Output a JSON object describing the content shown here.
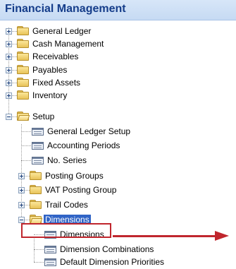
{
  "header": {
    "title": "Financial Management"
  },
  "tree": {
    "items": [
      {
        "label": "General Ledger",
        "kind": "folder",
        "state": "collapsed"
      },
      {
        "label": "Cash Management",
        "kind": "folder",
        "state": "collapsed"
      },
      {
        "label": "Receivables",
        "kind": "folder",
        "state": "collapsed"
      },
      {
        "label": "Payables",
        "kind": "folder",
        "state": "collapsed"
      },
      {
        "label": "Fixed Assets",
        "kind": "folder",
        "state": "collapsed"
      },
      {
        "label": "Inventory",
        "kind": "folder",
        "state": "collapsed"
      },
      {
        "label": "Setup",
        "kind": "folder",
        "state": "expanded"
      },
      {
        "label": "General Ledger Setup",
        "kind": "page"
      },
      {
        "label": "Accounting Periods",
        "kind": "page"
      },
      {
        "label": "No. Series",
        "kind": "page"
      },
      {
        "label": "Posting Groups",
        "kind": "folder",
        "state": "collapsed"
      },
      {
        "label": "VAT Posting Group",
        "kind": "folder",
        "state": "collapsed"
      },
      {
        "label": "Trail Codes",
        "kind": "folder",
        "state": "collapsed"
      },
      {
        "label": "Dimensions",
        "kind": "folder",
        "state": "expanded",
        "selected": true
      },
      {
        "label": "Dimensions",
        "kind": "page",
        "highlighted": true
      },
      {
        "label": "Dimension Combinations",
        "kind": "page"
      },
      {
        "label": "Default Dimension Priorities",
        "kind": "page"
      }
    ]
  },
  "annotation": {
    "color": "#c0262d"
  },
  "colors": {
    "header_text": "#153d8a",
    "selection": "#3064c6"
  }
}
